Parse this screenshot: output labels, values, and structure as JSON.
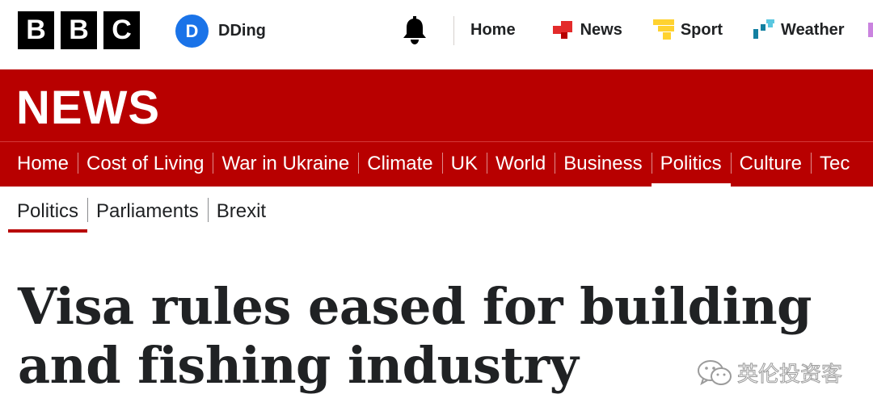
{
  "brand": {
    "letters": [
      "B",
      "B",
      "C"
    ]
  },
  "account": {
    "initial": "D",
    "name": "DDing"
  },
  "top_nav": {
    "items": [
      {
        "label": "Home",
        "icon": "none"
      },
      {
        "label": "News",
        "icon": "news-squares-icon"
      },
      {
        "label": "Sport",
        "icon": "sport-bars-icon"
      },
      {
        "label": "Weather",
        "icon": "weather-icon"
      }
    ],
    "notification_icon": "bell-icon"
  },
  "section_title": "NEWS",
  "sections": [
    {
      "label": "Home",
      "active": false
    },
    {
      "label": "Cost of Living",
      "active": false
    },
    {
      "label": "War in Ukraine",
      "active": false
    },
    {
      "label": "Climate",
      "active": false
    },
    {
      "label": "UK",
      "active": false
    },
    {
      "label": "World",
      "active": false
    },
    {
      "label": "Business",
      "active": false
    },
    {
      "label": "Politics",
      "active": true
    },
    {
      "label": "Culture",
      "active": false
    },
    {
      "label": "Tec",
      "active": false
    }
  ],
  "subnav": [
    {
      "label": "Politics",
      "active": true
    },
    {
      "label": "Parliaments",
      "active": false
    },
    {
      "label": "Brexit",
      "active": false
    }
  ],
  "headline": "Visa rules eased for building and fishing industry",
  "watermark": {
    "text": "英伦投资客",
    "icon": "wechat-icon"
  },
  "colors": {
    "brand_red": "#b80000",
    "text": "#202224",
    "avatar_blue": "#1a73e8"
  }
}
